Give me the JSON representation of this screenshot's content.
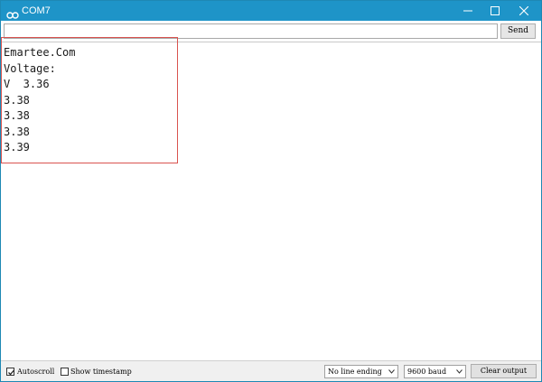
{
  "window": {
    "title": "COM7",
    "titlebar_color": "#1e94c8",
    "app_icon": "infinity-icon"
  },
  "send": {
    "input_value": "",
    "button_label": "Send"
  },
  "output": {
    "lines": [
      "Emartee.Com",
      "Voltage:",
      "V  3.36",
      "3.38",
      "3.38",
      "3.38",
      "3.39"
    ],
    "highlight_color": "#d9534f"
  },
  "toolbar": {
    "autoscroll_label": "Autoscroll",
    "autoscroll_checked": true,
    "timestamp_label": "Show timestamp",
    "timestamp_checked": false,
    "line_ending_value": "No line ending",
    "baud_value": "9600 baud",
    "clear_label": "Clear output"
  }
}
